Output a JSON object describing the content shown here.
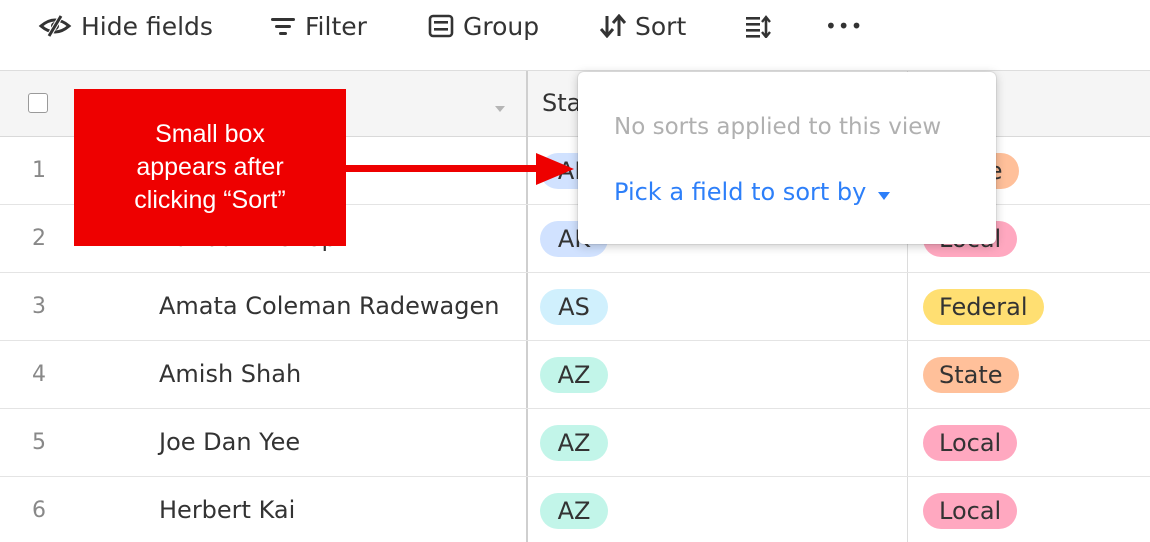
{
  "toolbar": {
    "hide_fields_label": "Hide fields",
    "filter_label": "Filter",
    "group_label": "Group",
    "sort_label": "Sort",
    "more_label": "•••",
    "icons": [
      "eye-slash-icon",
      "filter-icon",
      "group-icon",
      "sort-icon",
      "row-height-icon",
      "more-icon"
    ]
  },
  "grid": {
    "state_column_header": "Sta",
    "rows": [
      {
        "number": "1",
        "name": "",
        "state": "AK",
        "level": "State"
      },
      {
        "number": "2",
        "name": "Randall Bishop",
        "state": "AK",
        "level": "Local"
      },
      {
        "number": "3",
        "name": "Amata Coleman Radewagen",
        "state": "AS",
        "level": "Federal"
      },
      {
        "number": "4",
        "name": "Amish Shah",
        "state": "AZ",
        "level": "State"
      },
      {
        "number": "5",
        "name": "Joe Dan Yee",
        "state": "AZ",
        "level": "Local"
      },
      {
        "number": "6",
        "name": "Herbert Kai",
        "state": "AZ",
        "level": "Local"
      }
    ]
  },
  "sort_popover": {
    "empty_text": "No sorts applied to this view",
    "pick_field_label": "Pick a field to sort by"
  },
  "annotation": {
    "lines": [
      "Small box",
      "appears after",
      "clicking “Sort”"
    ]
  },
  "colors": {
    "accent_blue": "#2d7ff9",
    "annotation_red": "#ee0000",
    "pill_AK": "#d1e2ff",
    "pill_AS": "#d0f0fd",
    "pill_AZ": "#c2f5e9",
    "pill_State": "#ffc09a",
    "pill_Local": "#ffa8c0",
    "pill_Federal": "#ffdf72"
  }
}
